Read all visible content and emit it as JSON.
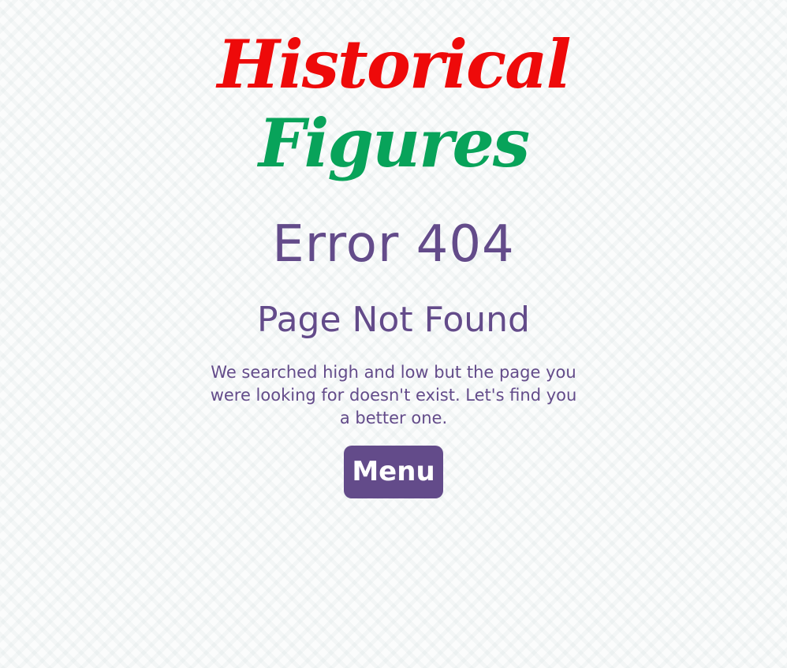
{
  "logo": {
    "line1": "Historical",
    "line2": "Figures",
    "line1_color": "#ee0a0a",
    "line2_color": "#08a35a"
  },
  "error": {
    "title": "Error 404",
    "subtitle": "Page Not Found",
    "message": "We searched high and low but the page you were looking for doesn't exist. Let's find you a better one."
  },
  "actions": {
    "menu_label": "Menu"
  },
  "colors": {
    "accent": "#634b8a",
    "background": "#fbfcfc"
  }
}
